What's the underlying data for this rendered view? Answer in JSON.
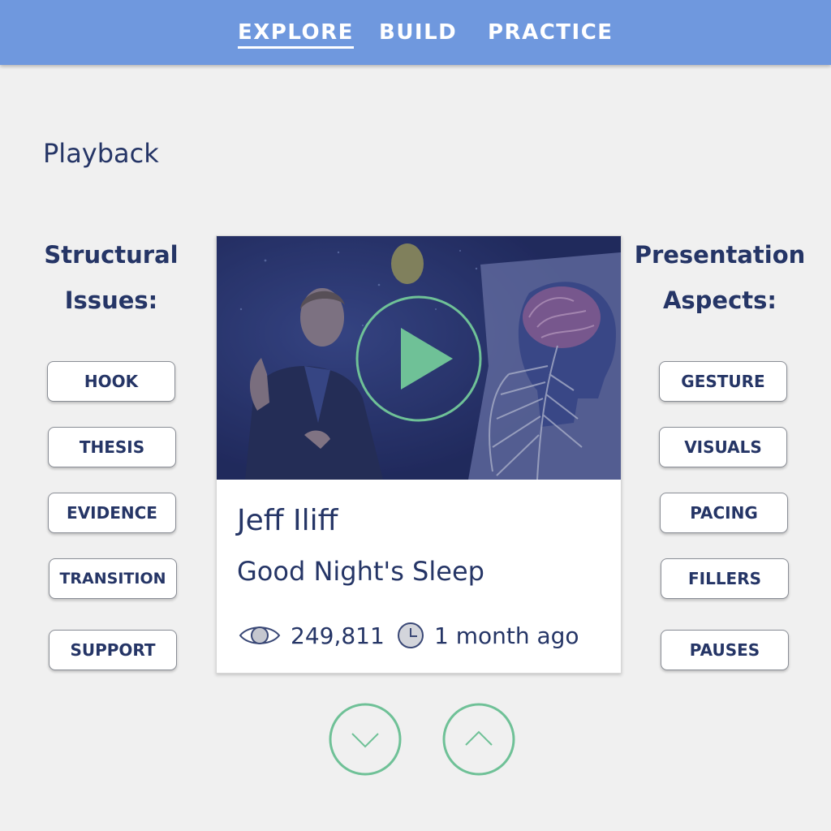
{
  "nav": {
    "tabs": [
      {
        "label": "EXPLORE",
        "active": true
      },
      {
        "label": "BUILD",
        "active": false
      },
      {
        "label": "PRACTICE",
        "active": false
      }
    ]
  },
  "page": {
    "title": "Playback"
  },
  "structural": {
    "heading_line1": "Structural",
    "heading_line2": "Issues:",
    "buttons": [
      "HOOK",
      "THESIS",
      "EVIDENCE",
      "TRANSITION",
      "SUPPORT"
    ]
  },
  "presentation": {
    "heading_line1": "Presentation",
    "heading_line2": "Aspects:",
    "buttons": [
      "GESTURE",
      "VISUALS",
      "PACING",
      "FILLERS",
      "PAUSES"
    ]
  },
  "video": {
    "speaker": "Jeff Iliff",
    "title": "Good Night's Sleep",
    "views": "249,811",
    "age": "1 month ago",
    "view_icon": "eye-icon",
    "time_icon": "clock-icon",
    "play_icon": "play-icon"
  },
  "controls": {
    "down_icon": "chevron-down-icon",
    "up_icon": "chevron-up-icon"
  },
  "colors": {
    "nav_bar": "#6f98de",
    "text_navy": "#253566",
    "accent_green": "#6fc197",
    "background": "#f0f0f0",
    "thumbnail_tint": "#27336a"
  }
}
